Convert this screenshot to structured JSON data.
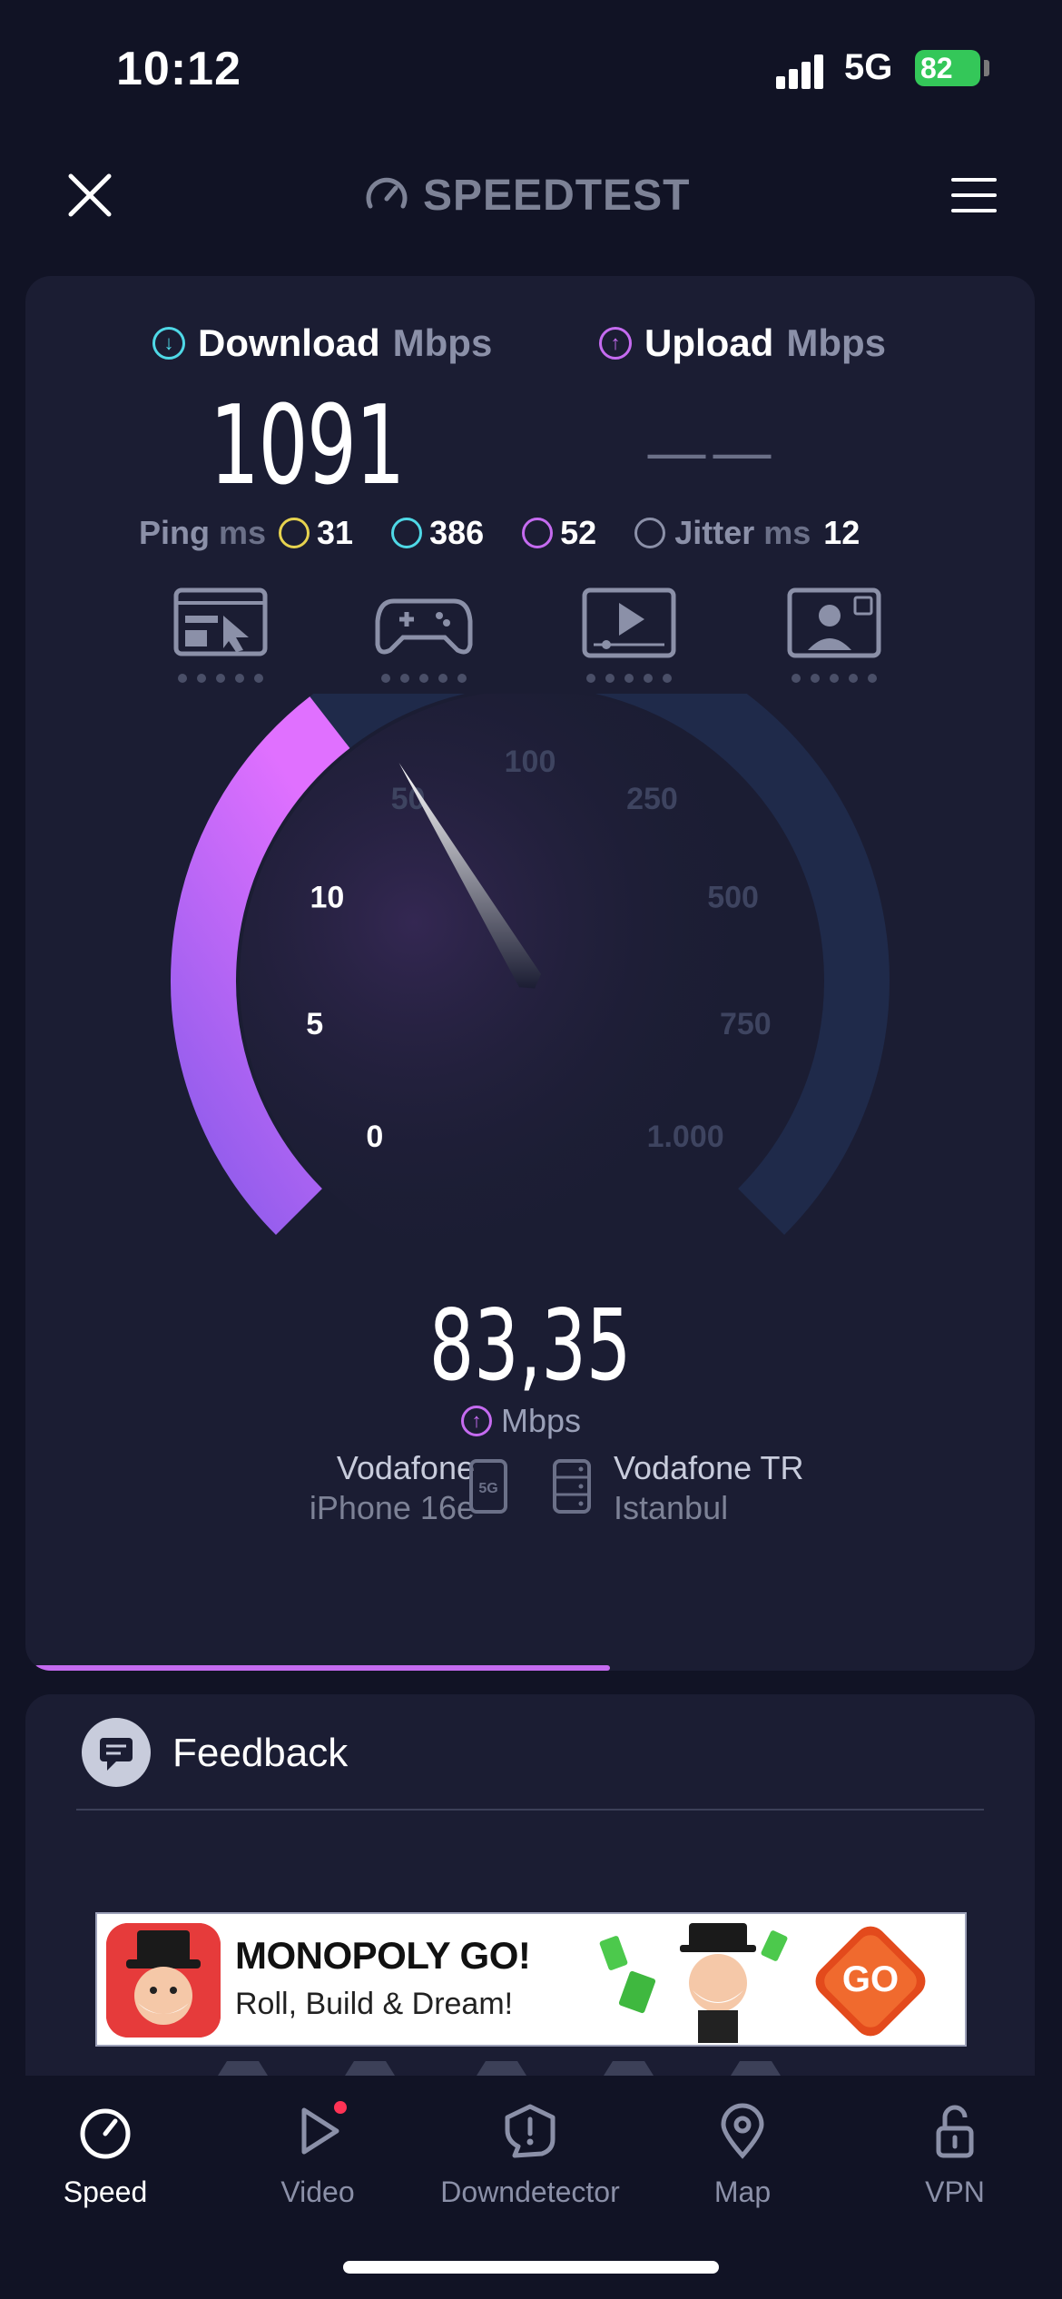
{
  "status_bar": {
    "time": "10:12",
    "network": "5G",
    "battery": "82"
  },
  "header": {
    "logo_text": "SPEEDTEST"
  },
  "results": {
    "download_label": "Download",
    "download_unit": "Mbps",
    "download_value": "1091",
    "upload_label": "Upload",
    "upload_unit": "Mbps",
    "upload_value": "——",
    "ping_label": "Ping",
    "ping_unit": "ms",
    "ping_idle": "31",
    "ping_download": "386",
    "ping_upload": "52",
    "jitter_label": "Jitter",
    "jitter_unit": "ms",
    "jitter_value": "12"
  },
  "quality_apps": [
    {
      "name": "browsing-icon"
    },
    {
      "name": "gaming-icon"
    },
    {
      "name": "video-streaming-icon"
    },
    {
      "name": "video-call-icon"
    }
  ],
  "gauge": {
    "scale_labels": [
      "0",
      "5",
      "10",
      "50",
      "100",
      "250",
      "500",
      "750",
      "1.000"
    ],
    "current_value": "83,35",
    "unit": "Mbps",
    "fill_fraction": 0.36,
    "accent_color": "#c56bf0",
    "track_color": "#1f2a4a"
  },
  "server": {
    "provider": "Vodafone",
    "device": "iPhone 16e",
    "host": "Vodafone TR",
    "city": "Istanbul"
  },
  "test_progress_fraction": 0.57,
  "feedback": {
    "label": "Feedback"
  },
  "ad": {
    "title": "MONOPOLY GO!",
    "subtitle": "Roll, Build & Dream!",
    "cta": "GO"
  },
  "tabs": [
    {
      "label": "Speed",
      "icon": "speedometer-icon",
      "active": true
    },
    {
      "label": "Video",
      "icon": "play-icon",
      "active": false
    },
    {
      "label": "Downdetector",
      "icon": "alert-icon",
      "active": false
    },
    {
      "label": "Map",
      "icon": "map-pin-icon",
      "active": false
    },
    {
      "label": "VPN",
      "icon": "unlock-icon",
      "active": false
    }
  ]
}
